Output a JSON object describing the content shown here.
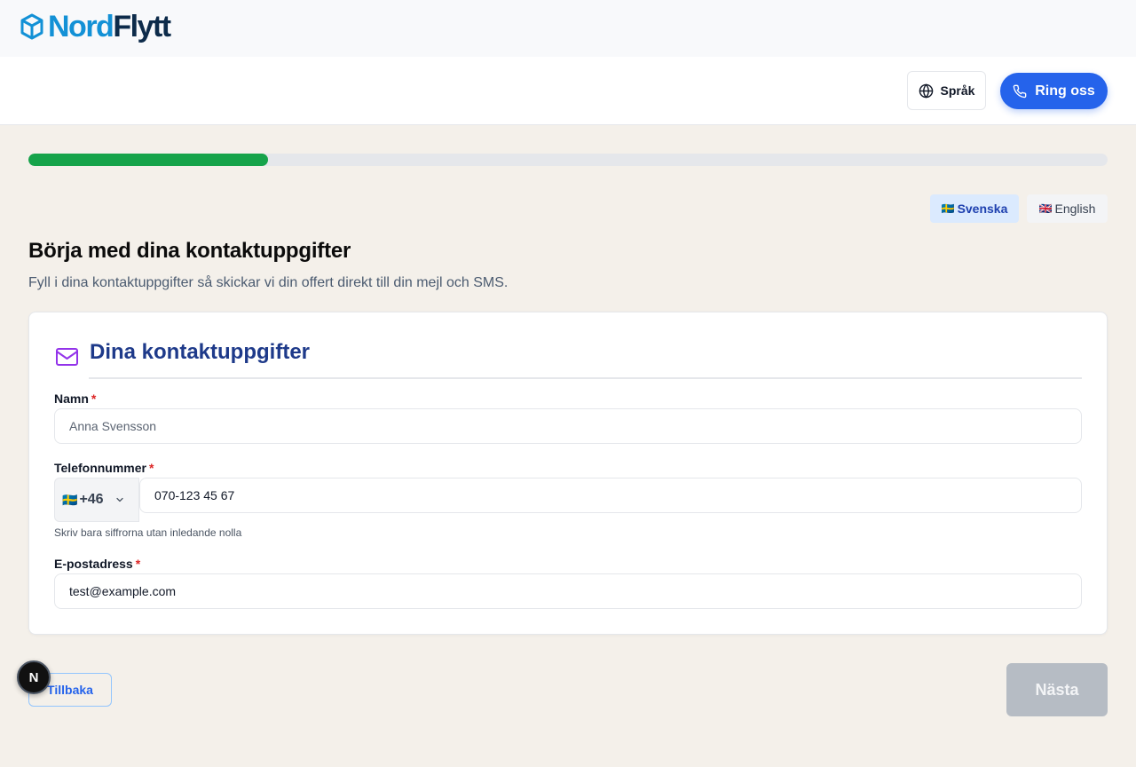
{
  "brand": {
    "name_part1": "Nord",
    "name_part2": "Flytt"
  },
  "header": {
    "language_button": "Språk",
    "call_button": "Ring oss"
  },
  "progress": {
    "percent": 22.2
  },
  "language_toggle": {
    "options": [
      {
        "flag": "🇸🇪",
        "label": "Svenska",
        "selected": true
      },
      {
        "flag": "🇬🇧",
        "label": "English",
        "selected": false
      }
    ]
  },
  "page": {
    "title": "Börja med dina kontaktuppgifter",
    "subtitle": "Fyll i dina kontaktuppgifter så skickar vi din offert direkt till din mejl och SMS."
  },
  "card": {
    "title": "Dina kontaktuppgifter",
    "fields": {
      "name": {
        "label": "Namn",
        "required_mark": "*",
        "placeholder": "Anna Svensson",
        "value": ""
      },
      "phone": {
        "label": "Telefonnummer",
        "required_mark": "*",
        "country_flag": "🇸🇪",
        "country_code": "+46",
        "value": "070-123 45 67",
        "helper": "Skriv bara siffrorna utan inledande nolla"
      },
      "email": {
        "label": "E-postadress",
        "required_mark": "*",
        "value": "test@example.com"
      }
    }
  },
  "footer": {
    "back_button": "Tillbaka",
    "next_button": "Nästa",
    "dev_badge": "N"
  },
  "colors": {
    "primary": "#2563eb",
    "progress": "#16a34a",
    "card_title": "#1e3a8a",
    "required": "#dc2626",
    "mail_icon": "#9333ea",
    "disabled": "#b6bcc4"
  }
}
